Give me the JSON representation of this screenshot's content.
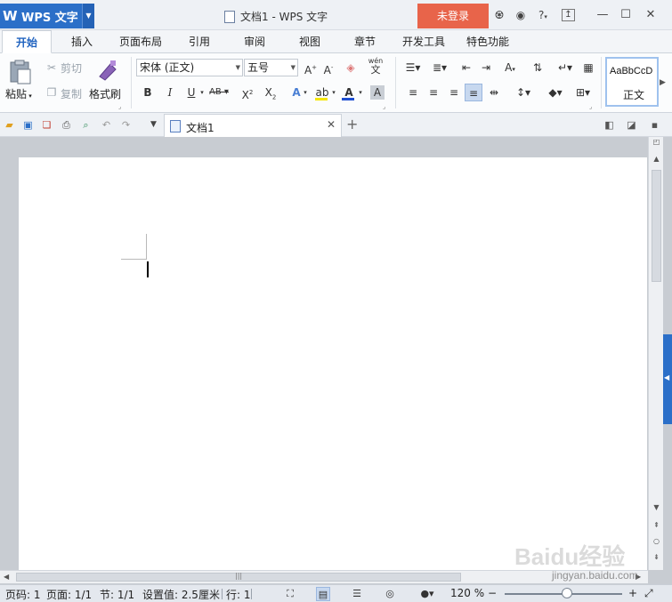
{
  "titlebar": {
    "app_name": "WPS 文字",
    "doc_title": "文档1 - WPS 文字",
    "login_label": "未登录",
    "help_label": "?",
    "colors": {
      "app_blue": "#2b6fc8",
      "login_orange": "#e8644a"
    }
  },
  "tabs": [
    "开始",
    "插入",
    "页面布局",
    "引用",
    "审阅",
    "视图",
    "章节",
    "开发工具",
    "特色功能"
  ],
  "ribbon": {
    "paste_label": "粘贴",
    "cut_label": "剪切",
    "copy_label": "复制",
    "format_painter_label": "格式刷",
    "font_name": "宋体 (正文)",
    "font_size": "五号",
    "style_preview": "AaBbCcD",
    "style_name": "正文",
    "pinyin_label": "wén",
    "pinyin_char": "文",
    "font_color": "#1f4fd1",
    "highlight_color": "#f5e600"
  },
  "quickbar": {
    "doc_tab_label": "文档1"
  },
  "status": {
    "page_no": "页码: 1",
    "page_count": "页面: 1/1",
    "section": "节: 1/1",
    "setting": "设置值: 2.5厘米",
    "line": "行: 1",
    "zoom": "120 %"
  },
  "watermark": {
    "line1": "Baidu经验",
    "line2": "jingyan.baidu.com"
  }
}
